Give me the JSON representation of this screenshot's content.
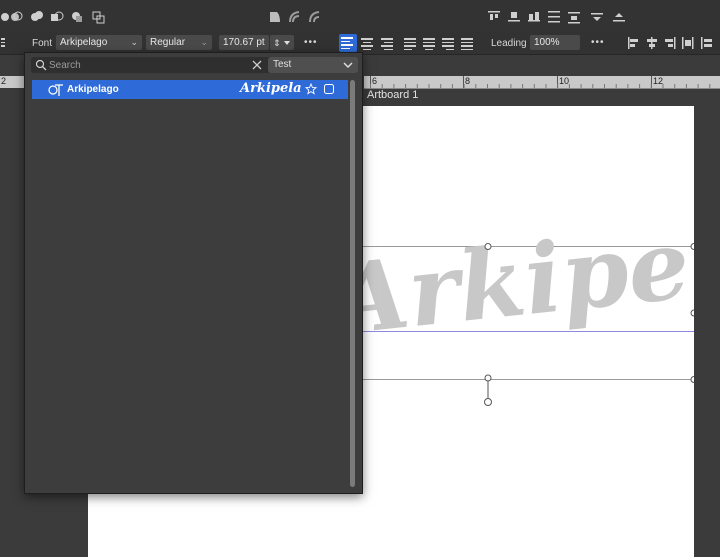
{
  "toolbar": {
    "font_label": "Font",
    "font_family": "Arkipelago",
    "font_style": "Regular",
    "font_size": "170.67 pt",
    "more_label": "•••",
    "leading_label": "Leading",
    "leading_value": "100%"
  },
  "ruler": {
    "ticks": [
      "2",
      "6",
      "8",
      "10",
      "12"
    ]
  },
  "artboard": {
    "label": "Artboard 1",
    "sample_text": "Arkipelago"
  },
  "font_panel": {
    "search_placeholder": "Search",
    "filter_value": "Test",
    "fonts": [
      {
        "name": "Arkipelago",
        "preview": "Arkipela"
      }
    ]
  },
  "colors": {
    "selection": "#2f6bd8",
    "panel": "#3d3d3d",
    "canvas_text": "#c8c8c8",
    "baseline": "#8a8ae0"
  }
}
